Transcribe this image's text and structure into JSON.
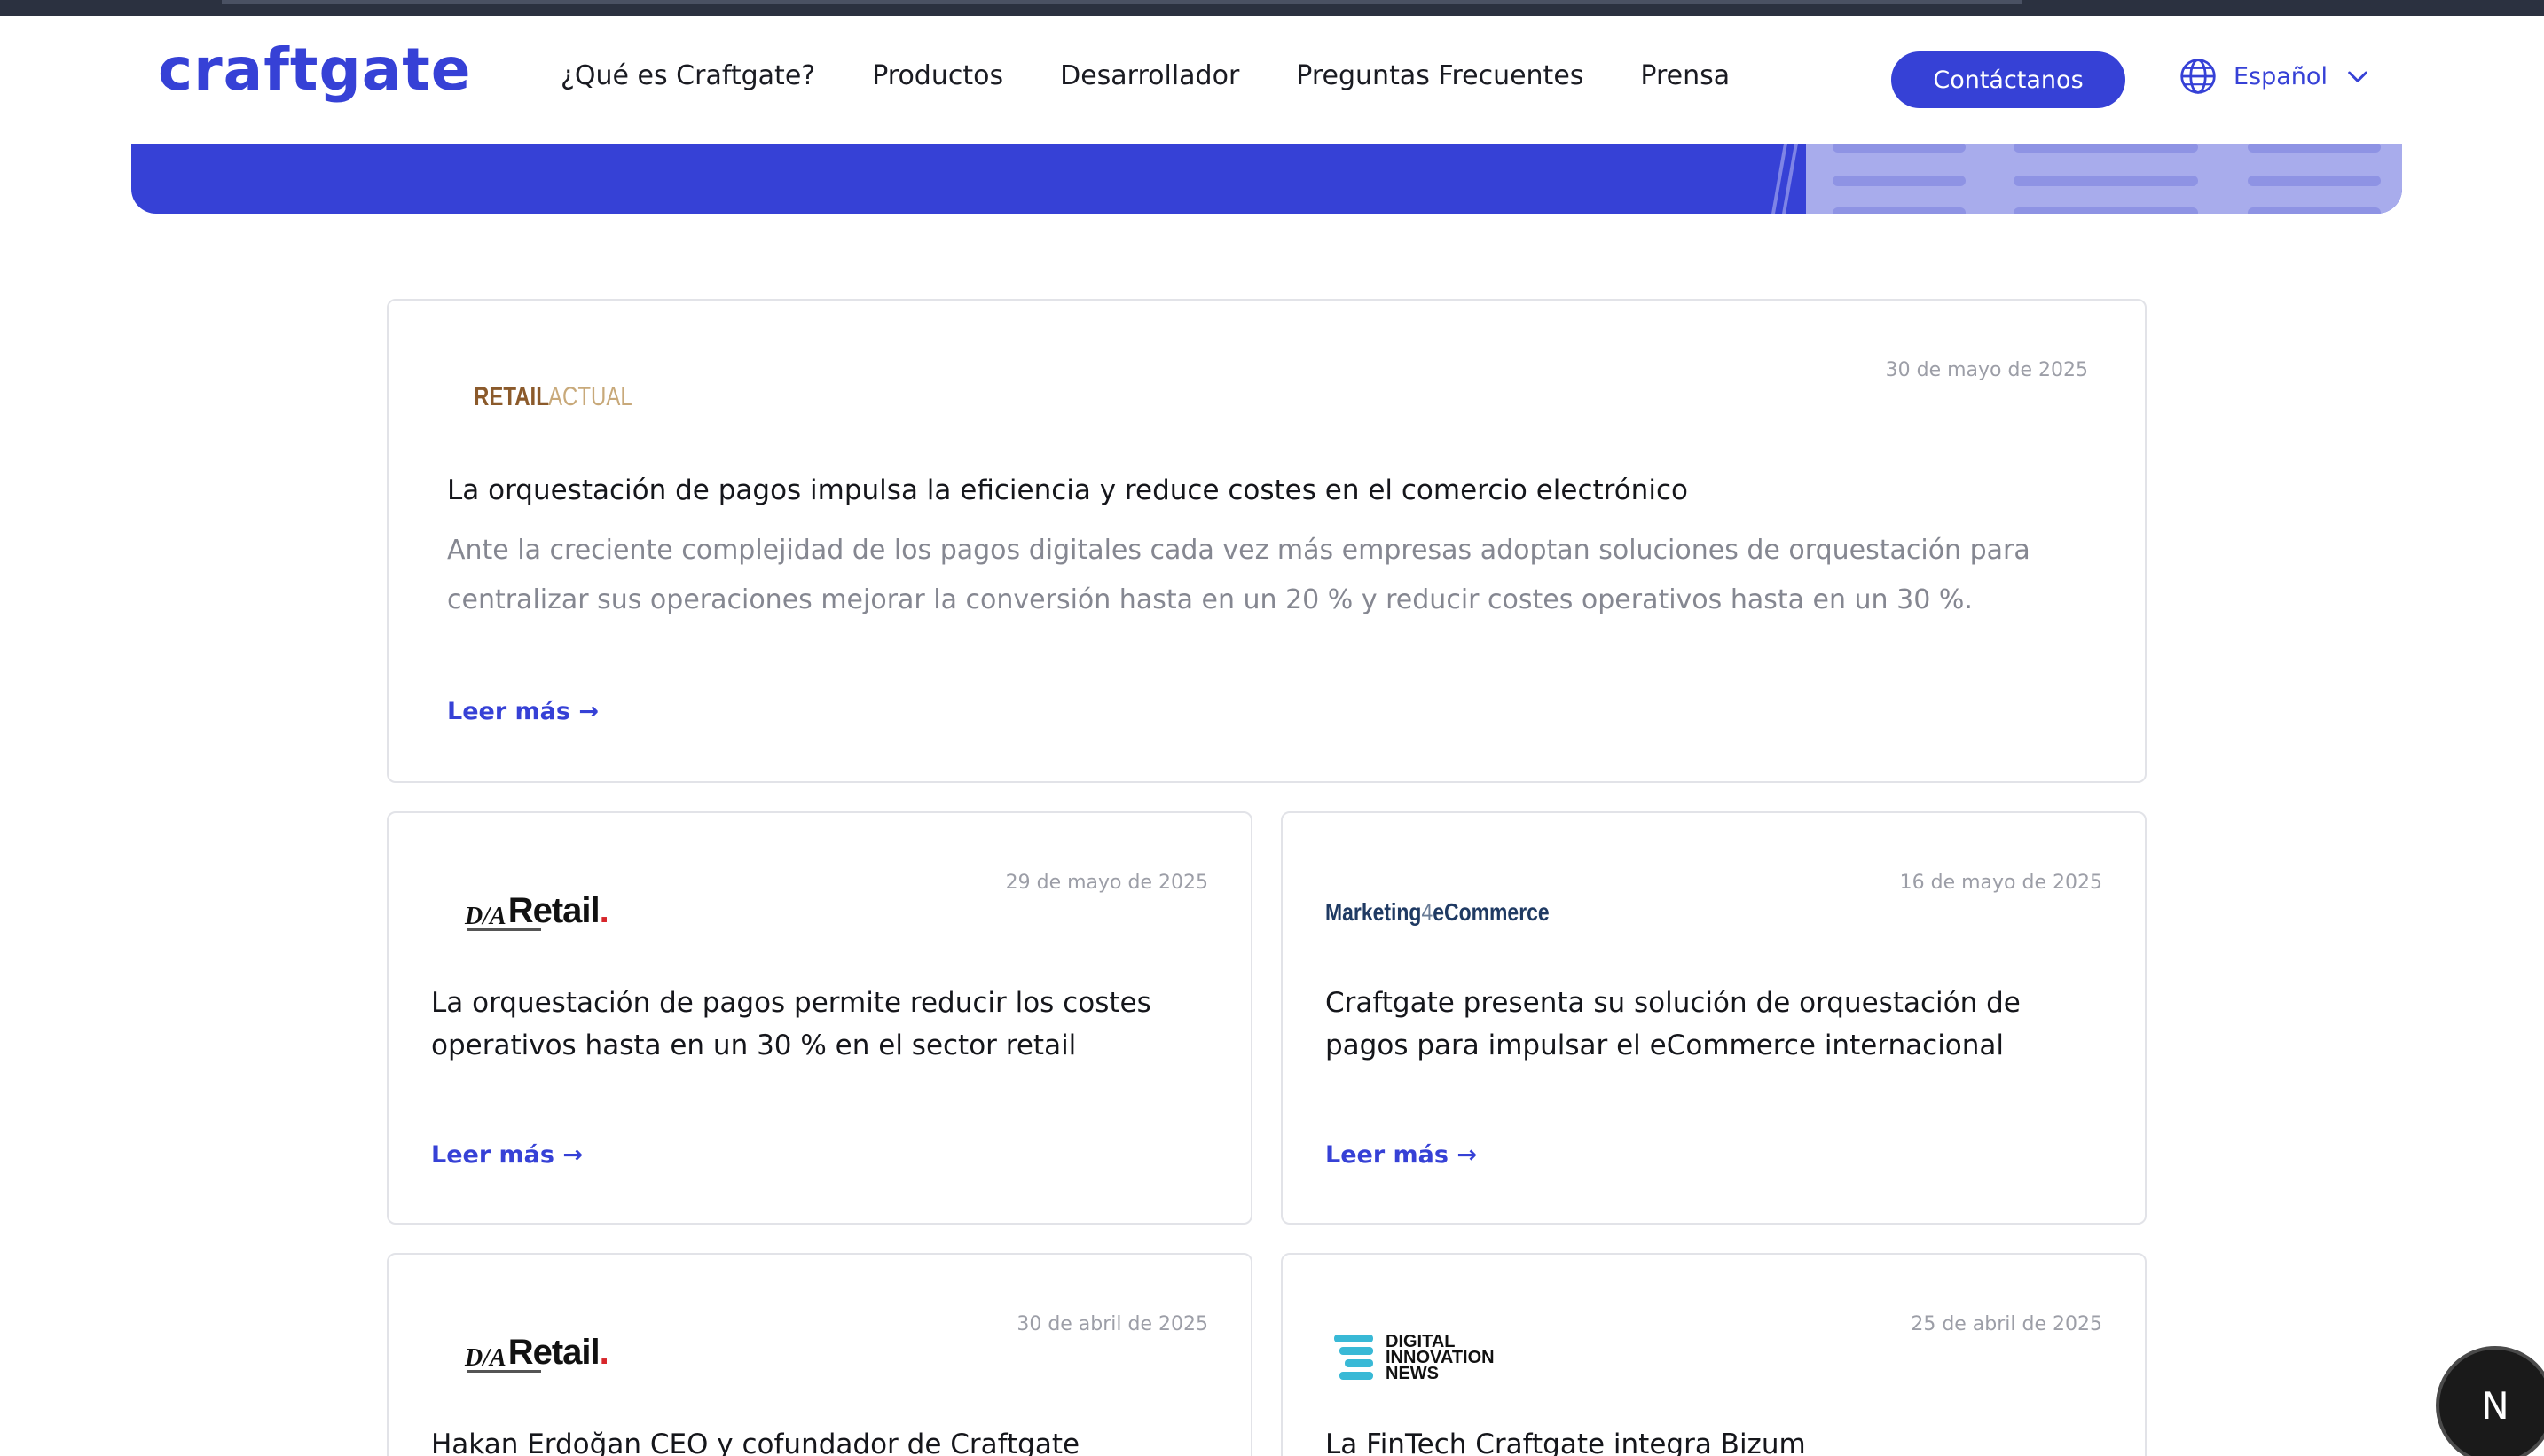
{
  "brand": {
    "logo_text": "craftgate",
    "accent": "#3641d6"
  },
  "nav": {
    "items": [
      {
        "label": "¿Qué es Craftgate?"
      },
      {
        "label": "Productos"
      },
      {
        "label": "Desarrollador"
      },
      {
        "label": "Preguntas Frecuentes"
      },
      {
        "label": "Prensa"
      }
    ],
    "contact_label": "Contáctanos",
    "language": {
      "label": "Español",
      "icon": "globe-icon"
    }
  },
  "press": {
    "read_more_label": "Leer más →",
    "cards": [
      {
        "source": "Retail Actual",
        "logo_text_1": "RETAIL",
        "logo_text_2": "ACTUAL",
        "date": "30 de mayo de 2025",
        "title": "La orquestación de pagos impulsa la eficiencia y reduce costes en el comercio electrónico",
        "excerpt": "Ante la creciente complejidad de los pagos digitales cada vez más empresas adoptan soluciones de orquestación para centralizar sus operaciones mejorar la conversión hasta en un 20 % y reducir costes operativos hasta en un 30 %."
      },
      {
        "source": "DA Retail",
        "logo_prefix": "D/A",
        "logo_text": "Retail",
        "date": "29 de mayo de 2025",
        "title": "La orquestación de pagos permite reducir los costes operativos hasta en un 30 % en el sector retail"
      },
      {
        "source": "Marketing 4 eCommerce",
        "logo_text": "Marketing",
        "logo_sep": "4",
        "logo_text_2": "eCommerce",
        "date": "16 de mayo de 2025",
        "title": "Craftgate presenta su solución de orquestación de pagos para impulsar el eCommerce internacional"
      },
      {
        "source": "DA Retail",
        "logo_prefix": "D/A",
        "logo_text": "Retail",
        "date": "30 de abril de 2025",
        "title": "Hakan Erdoğan CEO y cofundador de Craftgate"
      },
      {
        "source": "Digital Innovation News",
        "logo_line_1": "DIGITAL",
        "logo_line_2": "INNOVATION",
        "logo_line_3": "NEWS",
        "date": "25 de abril de 2025",
        "title": "La FinTech Craftgate integra Bizum"
      }
    ]
  },
  "fab": {
    "label": "N"
  }
}
